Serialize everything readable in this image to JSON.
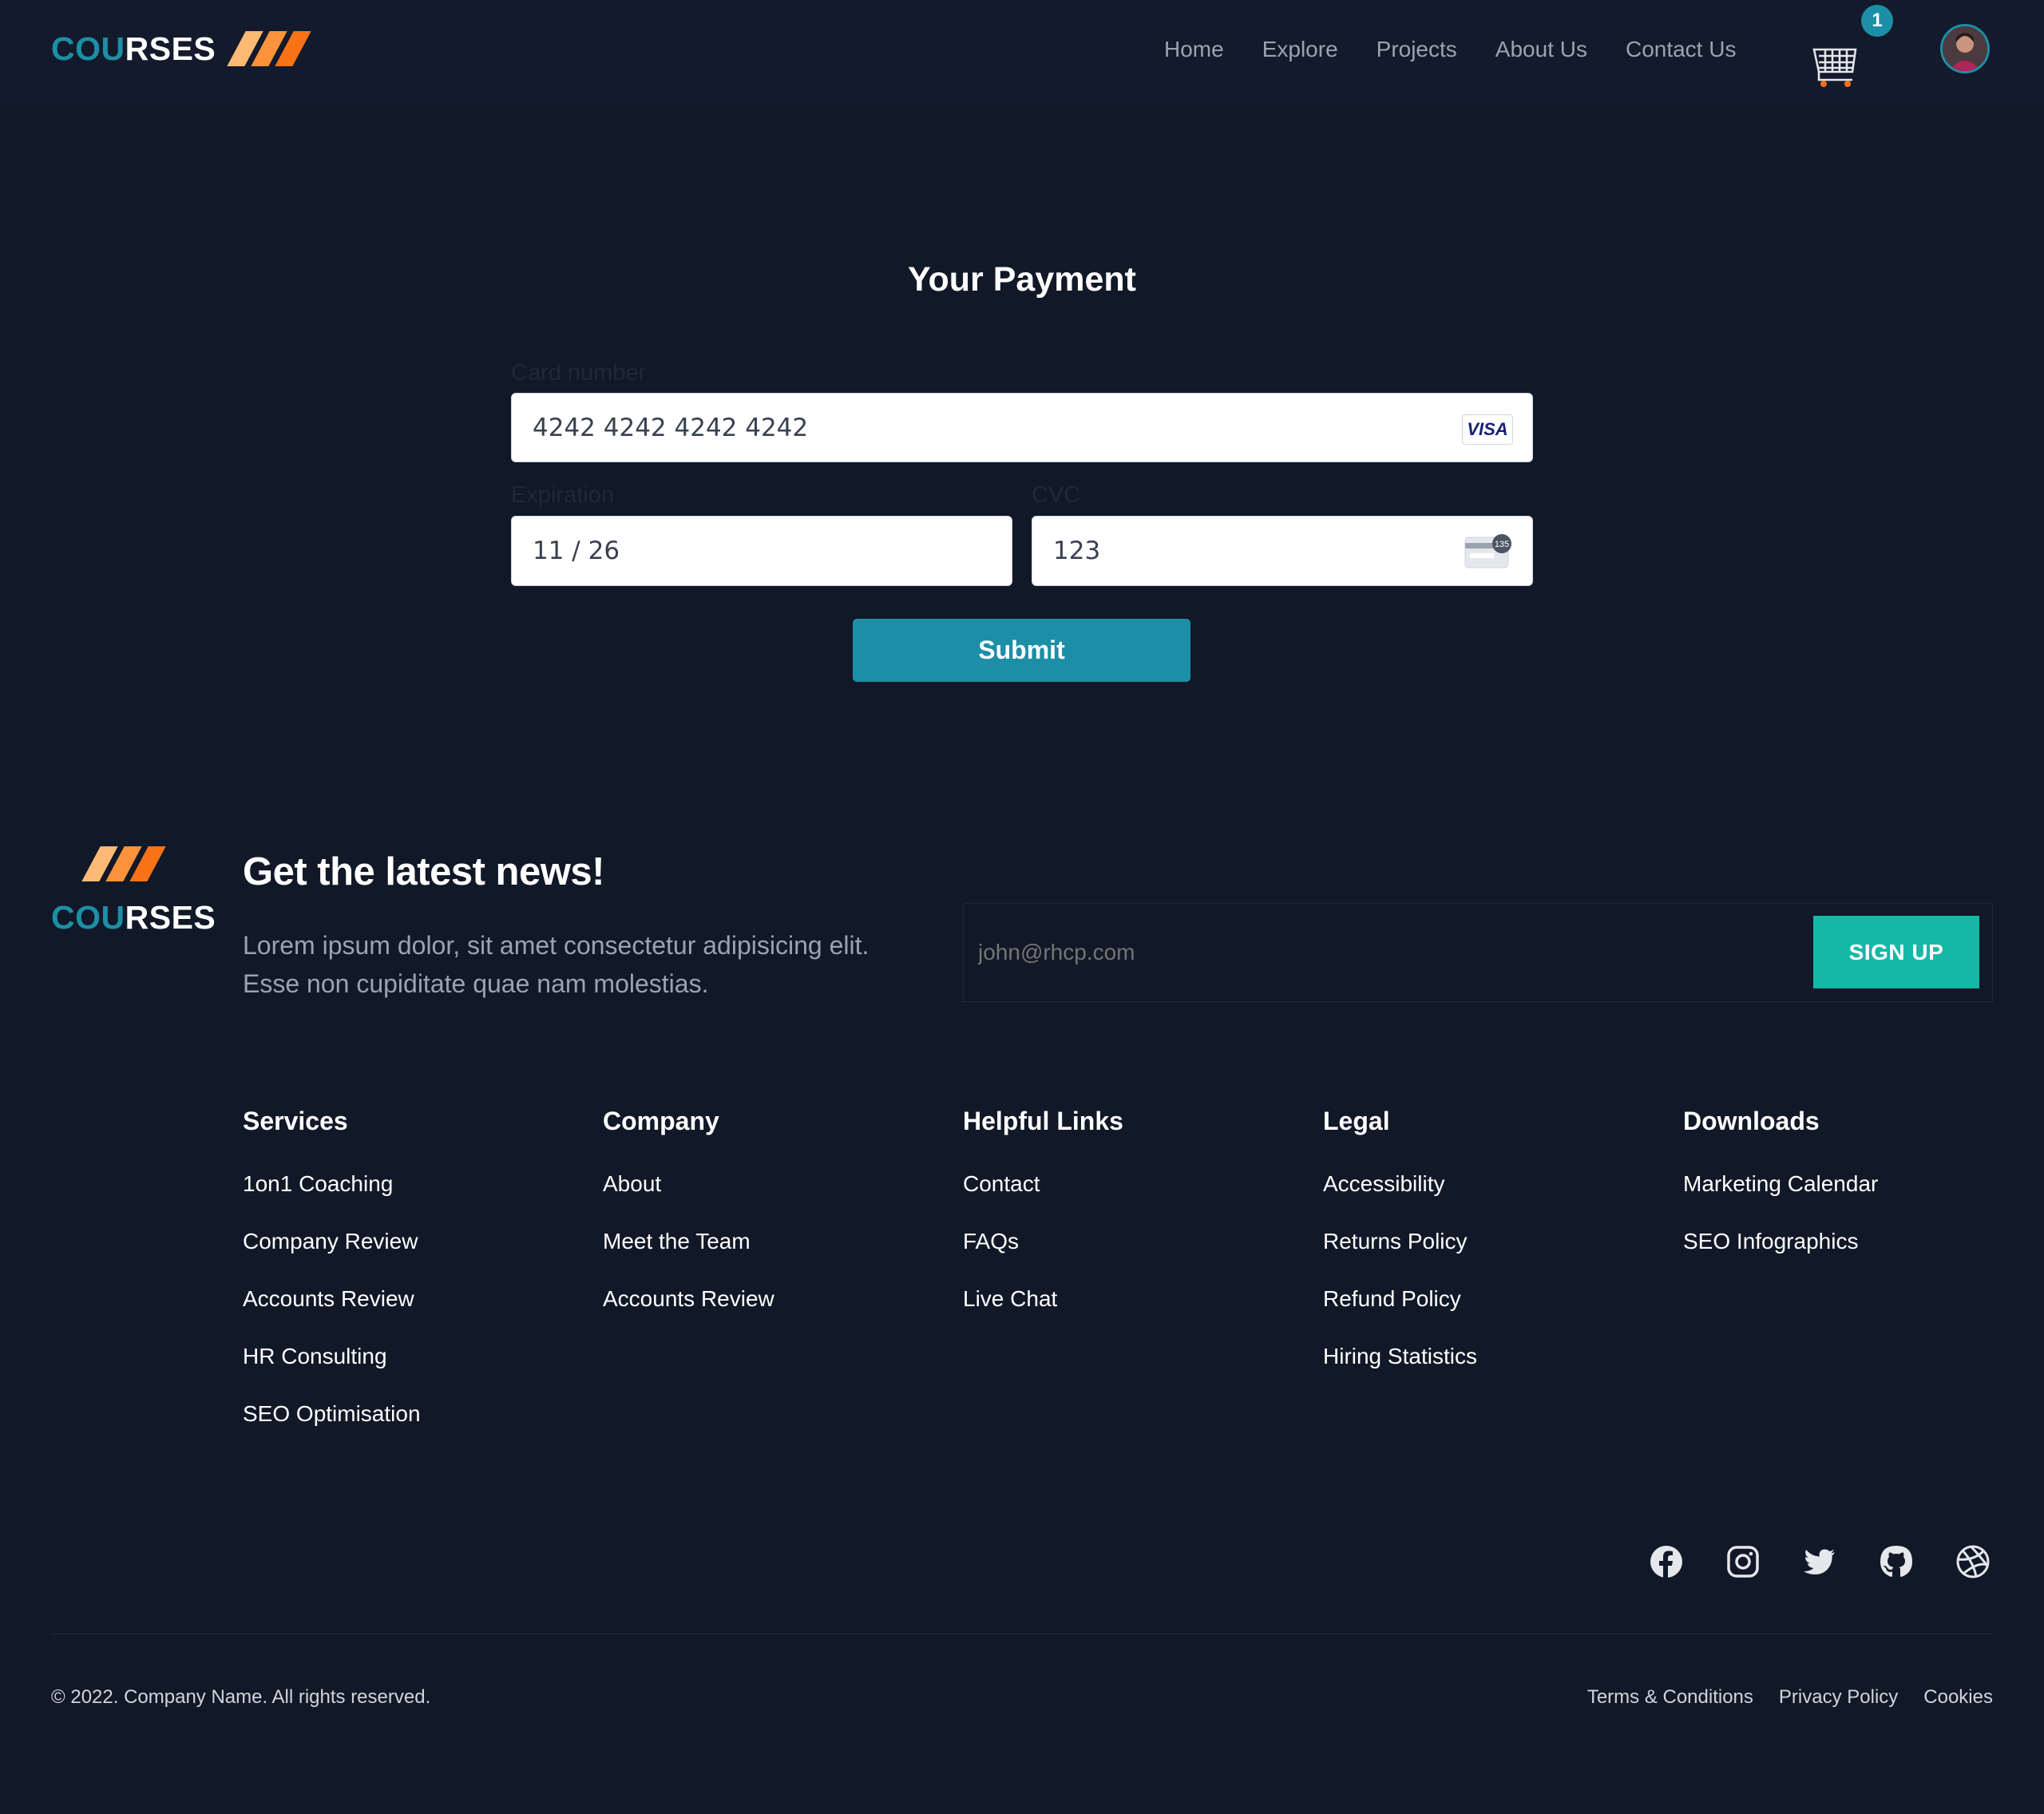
{
  "header": {
    "logo": {
      "accent": "COU",
      "rest": "RSES"
    },
    "nav": [
      "Home",
      "Explore",
      "Projects",
      "About Us",
      "Contact Us"
    ],
    "cart_count": "1"
  },
  "payment": {
    "title": "Your Payment",
    "card_label": "Card number",
    "card_value": "4242 4242 4242 4242",
    "card_brand": "VISA",
    "expiration_label": "Expiration",
    "expiration_value": "11 / 26",
    "cvc_label": "CVC",
    "cvc_value": "123",
    "cvc_icon_text": "135",
    "submit_label": "Submit"
  },
  "newsletter": {
    "title": "Get the latest news!",
    "text": "Lorem ipsum dolor, sit amet consectetur adipisicing elit. Esse non cupiditate quae nam molestias.",
    "email_placeholder": "john@rhcp.com",
    "signup_label": "SIGN UP"
  },
  "footer": {
    "columns": [
      {
        "title": "Services",
        "links": [
          "1on1 Coaching",
          "Company Review",
          "Accounts Review",
          "HR Consulting",
          "SEO Optimisation"
        ]
      },
      {
        "title": "Company",
        "links": [
          "About",
          "Meet the Team",
          "Accounts Review"
        ]
      },
      {
        "title": "Helpful Links",
        "links": [
          "Contact",
          "FAQs",
          "Live Chat"
        ]
      },
      {
        "title": "Legal",
        "links": [
          "Accessibility",
          "Returns Policy",
          "Refund Policy",
          "Hiring Statistics"
        ]
      },
      {
        "title": "Downloads",
        "links": [
          "Marketing Calendar",
          "SEO Infographics"
        ]
      }
    ],
    "social_icons": [
      "facebook-icon",
      "instagram-icon",
      "twitter-icon",
      "github-icon",
      "dribbble-icon"
    ],
    "copyright": "© 2022. Company Name. All rights reserved.",
    "legal_links": [
      "Terms & Conditions",
      "Privacy Policy",
      "Cookies"
    ]
  },
  "colors": {
    "background": "#111827",
    "header_background": "#121a2b",
    "accent_teal": "#1c8fa6",
    "signup_teal": "#14b8a6",
    "logo_orange": "#f97316",
    "logo_orange_light": "#fdba74"
  }
}
